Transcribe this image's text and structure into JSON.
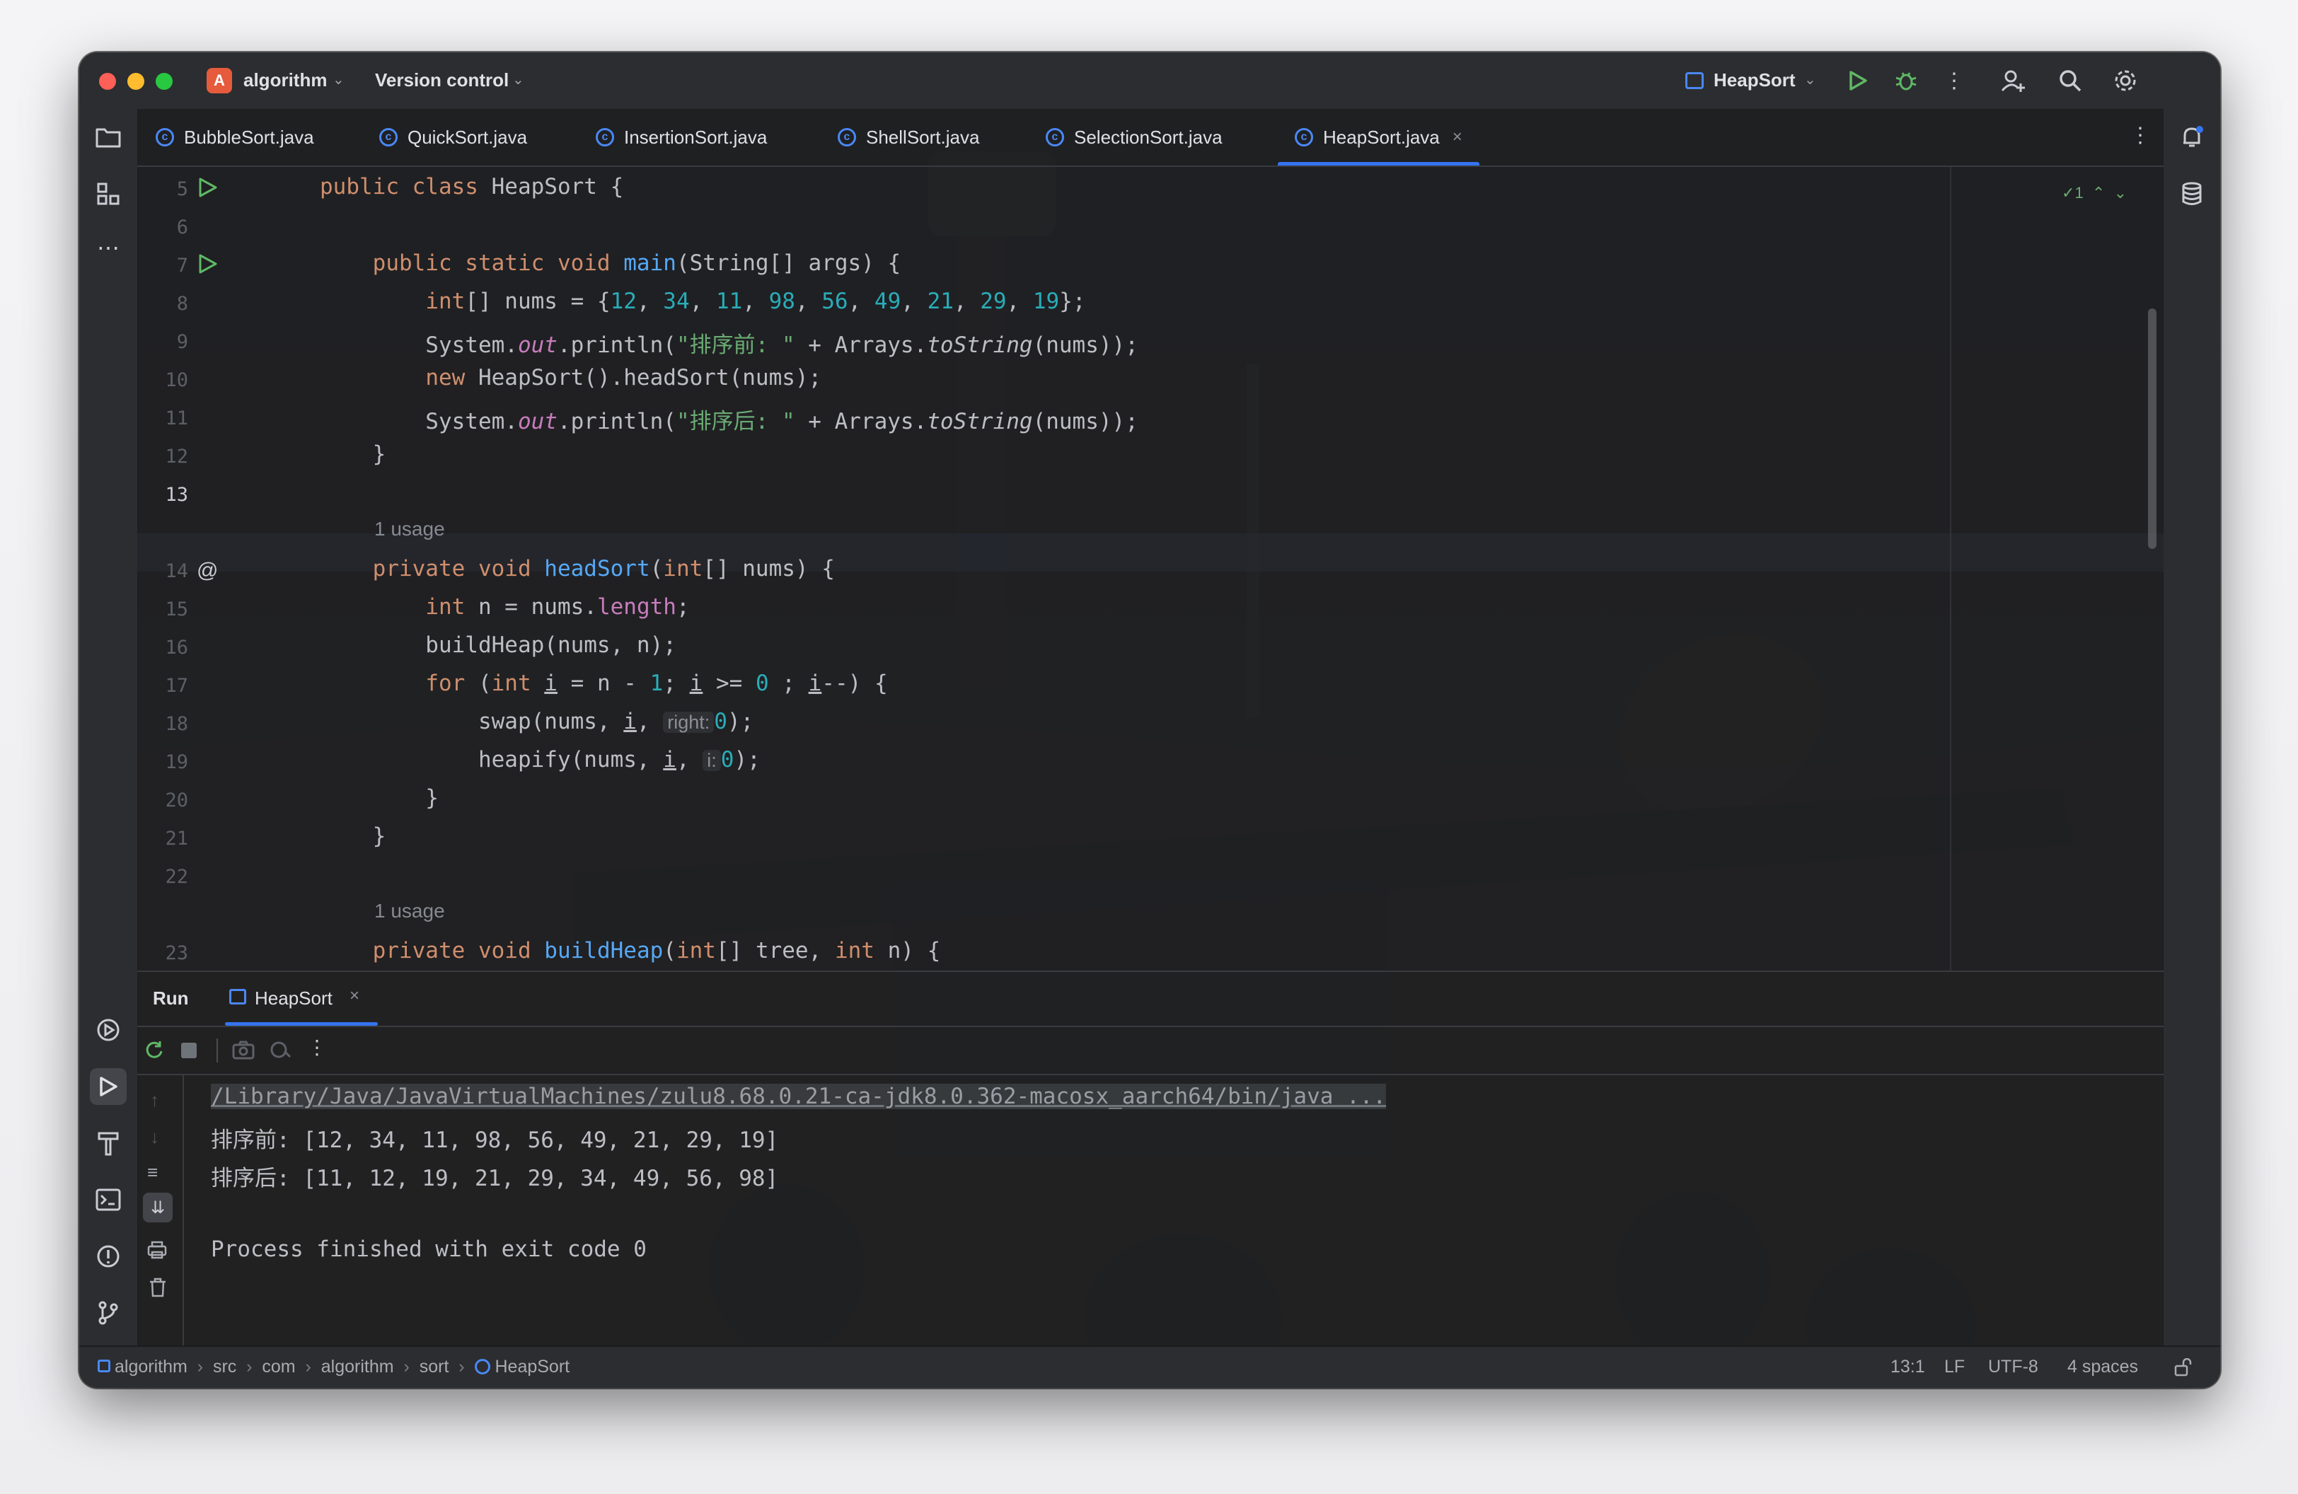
{
  "titlebar": {
    "project_badge": "A",
    "project_name": "algorithm",
    "vcs_label": "Version control",
    "run_config": "HeapSort",
    "icons": [
      "run-icon",
      "debug-icon",
      "more-icon",
      "add-user-icon",
      "search-icon",
      "settings-icon"
    ]
  },
  "tabs": [
    {
      "label": "BubbleSort.java"
    },
    {
      "label": "QuickSort.java"
    },
    {
      "label": "InsertionSort.java"
    },
    {
      "label": "ShellSort.java"
    },
    {
      "label": "SelectionSort.java"
    },
    {
      "label": "HeapSort.java",
      "active": true
    }
  ],
  "editor": {
    "inspection": "1",
    "line_numbers": [
      "5",
      "6",
      "7",
      "8",
      "9",
      "10",
      "11",
      "12",
      "13",
      "14",
      "15",
      "16",
      "17",
      "18",
      "19",
      "20",
      "21",
      "22",
      "23"
    ],
    "current_line": "13",
    "usage_hint_1": "1 usage",
    "usage_hint_2": "1 usage",
    "hint_right": "right:",
    "hint_i": "i:",
    "chinese_before": "\"排序前: \"",
    "chinese_after": "\"排序后: \""
  },
  "run_panel": {
    "title": "Run",
    "tab_label": "HeapSort",
    "console": [
      "/Library/Java/JavaVirtualMachines/zulu8.68.0.21-ca-jdk8.0.362-macosx_aarch64/bin/java ...",
      "排序前: [12, 34, 11, 98, 56, 49, 21, 29, 19]",
      "排序后: [11, 12, 19, 21, 29, 34, 49, 56, 98]",
      "",
      "Process finished with exit code 0"
    ]
  },
  "statusbar": {
    "breadcrumb": [
      "algorithm",
      "src",
      "com",
      "algorithm",
      "sort",
      "HeapSort"
    ],
    "position": "13:1",
    "line_sep": "LF",
    "encoding": "UTF-8",
    "indent": "4 spaces"
  },
  "colors": {
    "keyword": "#cf8e6d",
    "function": "#56a8f5",
    "number": "#2aacb8",
    "string": "#6aab73",
    "static_field": "#c77dbb",
    "accent": "#3574f0"
  }
}
